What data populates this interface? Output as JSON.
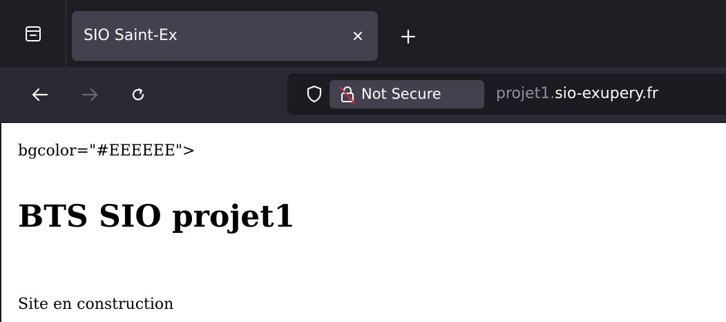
{
  "browser": {
    "tab": {
      "title": "SIO Saint-Ex",
      "close_icon": "close-icon"
    },
    "new_tab_icon": "plus-icon",
    "overview_icon": "tab-overview-icon",
    "nav": {
      "back_icon": "back-arrow-icon",
      "forward_icon": "forward-arrow-icon",
      "reload_icon": "reload-icon"
    },
    "urlbar": {
      "security_label": "Not Secure",
      "url_subdomain": "projet1.",
      "url_domain": "sio-exupery.fr"
    }
  },
  "page": {
    "raw_text": "bgcolor=\"#EEEEEE\">",
    "heading": "BTS SIO projet1",
    "paragraph": "Site en construction"
  },
  "colors": {
    "tabstrip_bg": "#1f1e25",
    "active_tab_bg": "#42414d",
    "navbar_bg": "#2b2a33",
    "urlbar_bg": "#1c1b22",
    "text_light": "#fbfbfe",
    "text_dim": "#8f8f9d",
    "insecure_red": "#e22850"
  }
}
